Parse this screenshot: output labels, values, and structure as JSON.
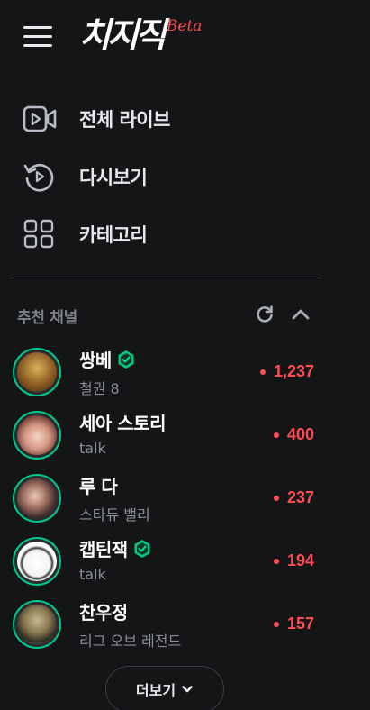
{
  "header": {
    "logo_text": "치지직",
    "logo_badge": "Beta"
  },
  "menu": {
    "items": [
      {
        "label": "전체 라이브",
        "icon": "video-icon"
      },
      {
        "label": "다시보기",
        "icon": "replay-icon"
      },
      {
        "label": "카테고리",
        "icon": "category-grid-icon"
      }
    ]
  },
  "recommended": {
    "title": "추천 채널",
    "more_label": "더보기",
    "channels": [
      {
        "name": "쌍베",
        "sub": "철권 8",
        "viewers": "1,237",
        "verified": true,
        "avatar_color": "#7a5a2a"
      },
      {
        "name": "세아 스토리",
        "sub": "talk",
        "viewers": "400",
        "verified": false,
        "avatar_color": "#c98d7a"
      },
      {
        "name": "루 다",
        "sub": "스타듀 밸리",
        "viewers": "237",
        "verified": false,
        "avatar_color": "#6b4a4a"
      },
      {
        "name": "캡틴잭",
        "sub": "talk",
        "viewers": "194",
        "verified": true,
        "avatar_color": "#e8e8e8"
      },
      {
        "name": "찬우정",
        "sub": "리그 오브 레전드",
        "viewers": "157",
        "verified": false,
        "avatar_color": "#8a7a5a"
      }
    ]
  },
  "colors": {
    "background": "#141517",
    "live_red": "#ff4d55",
    "verified_green": "#00c98a",
    "muted_text": "#8a8d95"
  }
}
